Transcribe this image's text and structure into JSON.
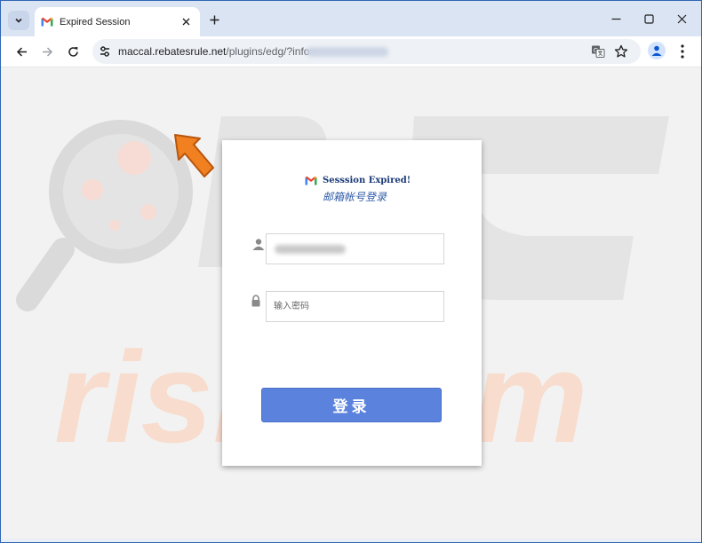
{
  "browser": {
    "tab_title": "Expired Session",
    "url_host": "maccal.rebatesrule.net",
    "url_path": "/plugins/edg/?info="
  },
  "watermark": {
    "text": "risk.com",
    "logo": "PC"
  },
  "login": {
    "brand_title": "Sesssion Expired!",
    "brand_subtitle": "邮箱帐号登录",
    "email_value": "",
    "password_placeholder": "输入密码",
    "submit_label": "登录"
  },
  "colors": {
    "brand_blue": "#1a3a78",
    "button_blue": "#5b82dc",
    "arrow_orange": "#f08020"
  },
  "icons": [
    "chevron-down-icon",
    "gmail-icon",
    "close-icon",
    "plus-icon",
    "minimize-icon",
    "maximize-icon",
    "back-icon",
    "forward-icon",
    "reload-icon",
    "site-info-icon",
    "translate-icon",
    "star-icon",
    "profile-icon",
    "kebab-menu-icon",
    "user-icon",
    "lock-icon"
  ]
}
